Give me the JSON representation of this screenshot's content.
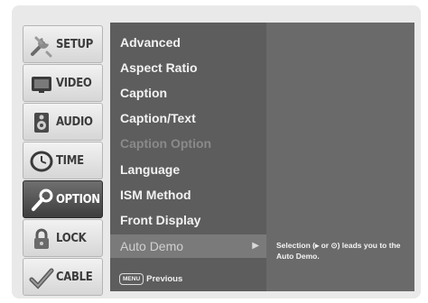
{
  "sidebar": {
    "tabs": [
      {
        "label": "SETUP",
        "icon": "setup-icon"
      },
      {
        "label": "VIDEO",
        "icon": "video-icon"
      },
      {
        "label": "AUDIO",
        "icon": "audio-icon"
      },
      {
        "label": "TIME",
        "icon": "clock-icon"
      },
      {
        "label": "OPTION",
        "icon": "option-icon",
        "selected": true
      },
      {
        "label": "LOCK",
        "icon": "lock-icon"
      },
      {
        "label": "CABLE",
        "icon": "cable-icon"
      }
    ]
  },
  "menu": {
    "items": [
      {
        "label": "Advanced"
      },
      {
        "label": "Aspect Ratio"
      },
      {
        "label": "Caption"
      },
      {
        "label": "Caption/Text"
      },
      {
        "label": "Caption Option",
        "disabled": true
      },
      {
        "label": "Language"
      },
      {
        "label": "ISM Method"
      },
      {
        "label": "Front Display"
      },
      {
        "label": "Auto Demo",
        "highlighted": true,
        "arrow": "▶"
      }
    ]
  },
  "panel": {
    "description": "Selection (▸ or ⊙) leads you to the Auto Demo."
  },
  "footer": {
    "menu_key": "MENU",
    "previous": "Previous"
  },
  "colors": {
    "menu_bg": "#5d5d5d",
    "panel_bg": "#6a6a6a",
    "highlight_bg": "#7a7a7a",
    "selected_tab_bg": "#4a4a4a"
  }
}
